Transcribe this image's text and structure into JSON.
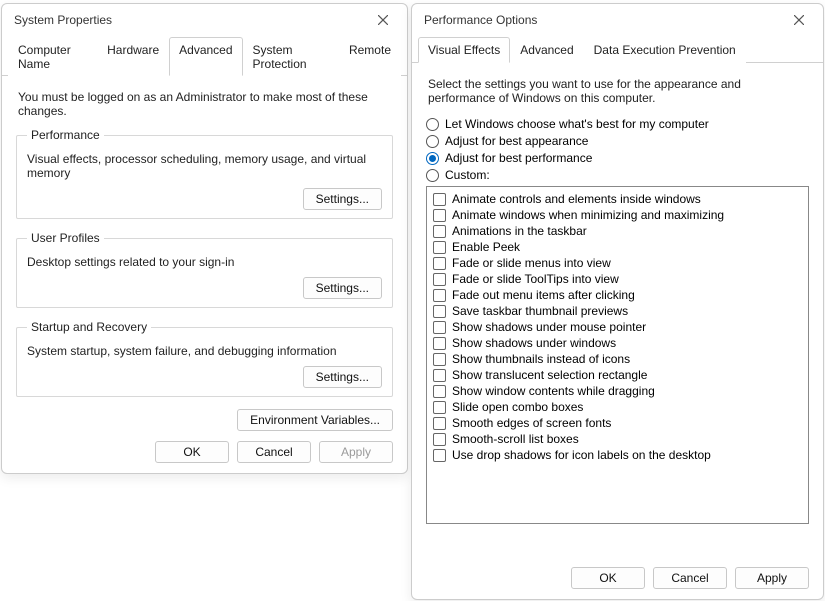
{
  "sysprops": {
    "title": "System Properties",
    "tabs": [
      "Computer Name",
      "Hardware",
      "Advanced",
      "System Protection",
      "Remote"
    ],
    "active_tab": 2,
    "admin_notice": "You must be logged on as an Administrator to make most of these changes.",
    "groups": {
      "performance": {
        "legend": "Performance",
        "desc": "Visual effects, processor scheduling, memory usage, and virtual memory",
        "btn": "Settings..."
      },
      "userprofiles": {
        "legend": "User Profiles",
        "desc": "Desktop settings related to your sign-in",
        "btn": "Settings..."
      },
      "startup": {
        "legend": "Startup and Recovery",
        "desc": "System startup, system failure, and debugging information",
        "btn": "Settings..."
      }
    },
    "env_btn": "Environment Variables...",
    "buttons": {
      "ok": "OK",
      "cancel": "Cancel",
      "apply": "Apply"
    }
  },
  "perfopts": {
    "title": "Performance Options",
    "tabs": [
      "Visual Effects",
      "Advanced",
      "Data Execution Prevention"
    ],
    "active_tab": 0,
    "intro": "Select the settings you want to use for the appearance and performance of Windows on this computer.",
    "radios": [
      {
        "label": "Let Windows choose what's best for my computer",
        "checked": false
      },
      {
        "label": "Adjust for best appearance",
        "checked": false
      },
      {
        "label": "Adjust for best performance",
        "checked": true
      },
      {
        "label": "Custom:",
        "checked": false
      }
    ],
    "effects": [
      "Animate controls and elements inside windows",
      "Animate windows when minimizing and maximizing",
      "Animations in the taskbar",
      "Enable Peek",
      "Fade or slide menus into view",
      "Fade or slide ToolTips into view",
      "Fade out menu items after clicking",
      "Save taskbar thumbnail previews",
      "Show shadows under mouse pointer",
      "Show shadows under windows",
      "Show thumbnails instead of icons",
      "Show translucent selection rectangle",
      "Show window contents while dragging",
      "Slide open combo boxes",
      "Smooth edges of screen fonts",
      "Smooth-scroll list boxes",
      "Use drop shadows for icon labels on the desktop"
    ],
    "buttons": {
      "ok": "OK",
      "cancel": "Cancel",
      "apply": "Apply"
    }
  }
}
